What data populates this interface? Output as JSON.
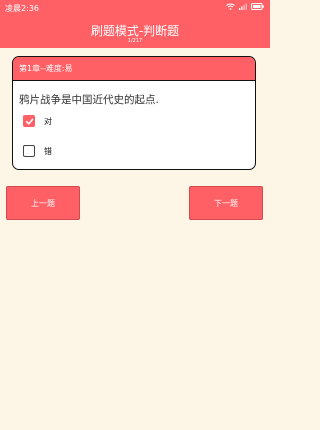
{
  "status_bar": {
    "time": "凌晨2:36",
    "icons": [
      "wifi-icon",
      "signal-icon",
      "battery-icon"
    ]
  },
  "header": {
    "title": "刷题模式-判断题",
    "subtitle": "1/217"
  },
  "card": {
    "header_label": "第1章--难度:易",
    "question": "鸦片战争是中国近代史的起点.",
    "options": [
      {
        "label": "对",
        "checked": true
      },
      {
        "label": "错",
        "checked": false
      }
    ]
  },
  "buttons": {
    "prev_label": "上一题",
    "next_label": "下一题"
  },
  "colors": {
    "accent": "#ff6066",
    "background": "#fdf6e6"
  }
}
